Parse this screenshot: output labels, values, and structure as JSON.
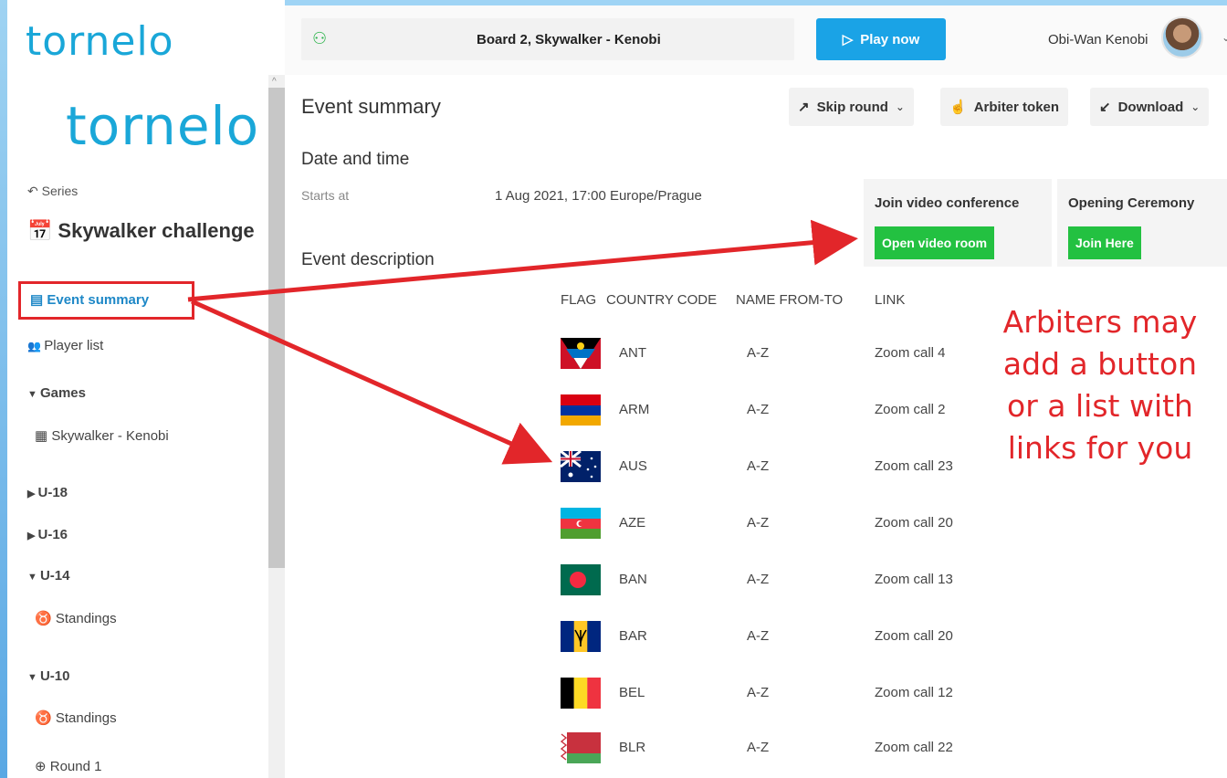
{
  "app": {
    "brand": "tornelo",
    "accent_color": "#1aa7d8"
  },
  "topbar": {
    "board_label": "Board 2, Skywalker - Kenobi",
    "board_icon": "players-icon",
    "play_label": "Play now",
    "user_name": "Obi-Wan Kenobi"
  },
  "sidebar": {
    "series_label": "Series",
    "event_name": "Skywalker challenge",
    "items": [
      {
        "label": "Event summary",
        "icon": "list-icon",
        "active": true
      },
      {
        "label": "Player list",
        "icon": "people-icon"
      },
      {
        "label": "Games",
        "icon": "triangle-down"
      },
      {
        "label": "Skywalker - Kenobi",
        "icon": "chessboard-icon"
      },
      {
        "label": "U-18",
        "icon": "triangle-right"
      },
      {
        "label": "U-16",
        "icon": "triangle-right"
      },
      {
        "label": "U-14",
        "icon": "triangle-down"
      },
      {
        "label": "Standings",
        "icon": "medal-icon"
      },
      {
        "label": "U-10",
        "icon": "triangle-down"
      },
      {
        "label": "Standings",
        "icon": "medal-icon"
      },
      {
        "label": "Round 1",
        "icon": "round-icon"
      }
    ]
  },
  "main": {
    "title": "Event summary",
    "toolbar": {
      "skip_round": "Skip round",
      "arbiter_token": "Arbiter token",
      "download": "Download"
    },
    "date_section": "Date and time",
    "starts_label": "Starts at",
    "starts_value": "1 Aug 2021, 17:00 Europe/Prague",
    "description_section": "Event description",
    "video_cards": [
      {
        "title": "Join video conference",
        "button": "Open video room"
      },
      {
        "title": "Opening Ceremony",
        "button": "Join Here"
      }
    ],
    "table": {
      "headers": [
        "FLAG",
        "COUNTRY CODE",
        "NAME FROM-TO",
        "LINK"
      ],
      "rows": [
        {
          "code": "ANT",
          "range": "A-Z",
          "link": "Zoom call 4"
        },
        {
          "code": "ARM",
          "range": "A-Z",
          "link": "Zoom call 2"
        },
        {
          "code": "AUS",
          "range": "A-Z",
          "link": "Zoom call 23"
        },
        {
          "code": "AZE",
          "range": "A-Z",
          "link": "Zoom call 20"
        },
        {
          "code": "BAN",
          "range": "A-Z",
          "link": "Zoom call 13"
        },
        {
          "code": "BAR",
          "range": "A-Z",
          "link": "Zoom call 20"
        },
        {
          "code": "BEL",
          "range": "A-Z",
          "link": "Zoom call 12"
        },
        {
          "code": "BLR",
          "range": "A-Z",
          "link": "Zoom call 22"
        }
      ]
    }
  },
  "annotation": {
    "lines": [
      "Arbiters may",
      "add a button",
      "or a list with",
      "links for you"
    ],
    "color": "#e2262a"
  }
}
